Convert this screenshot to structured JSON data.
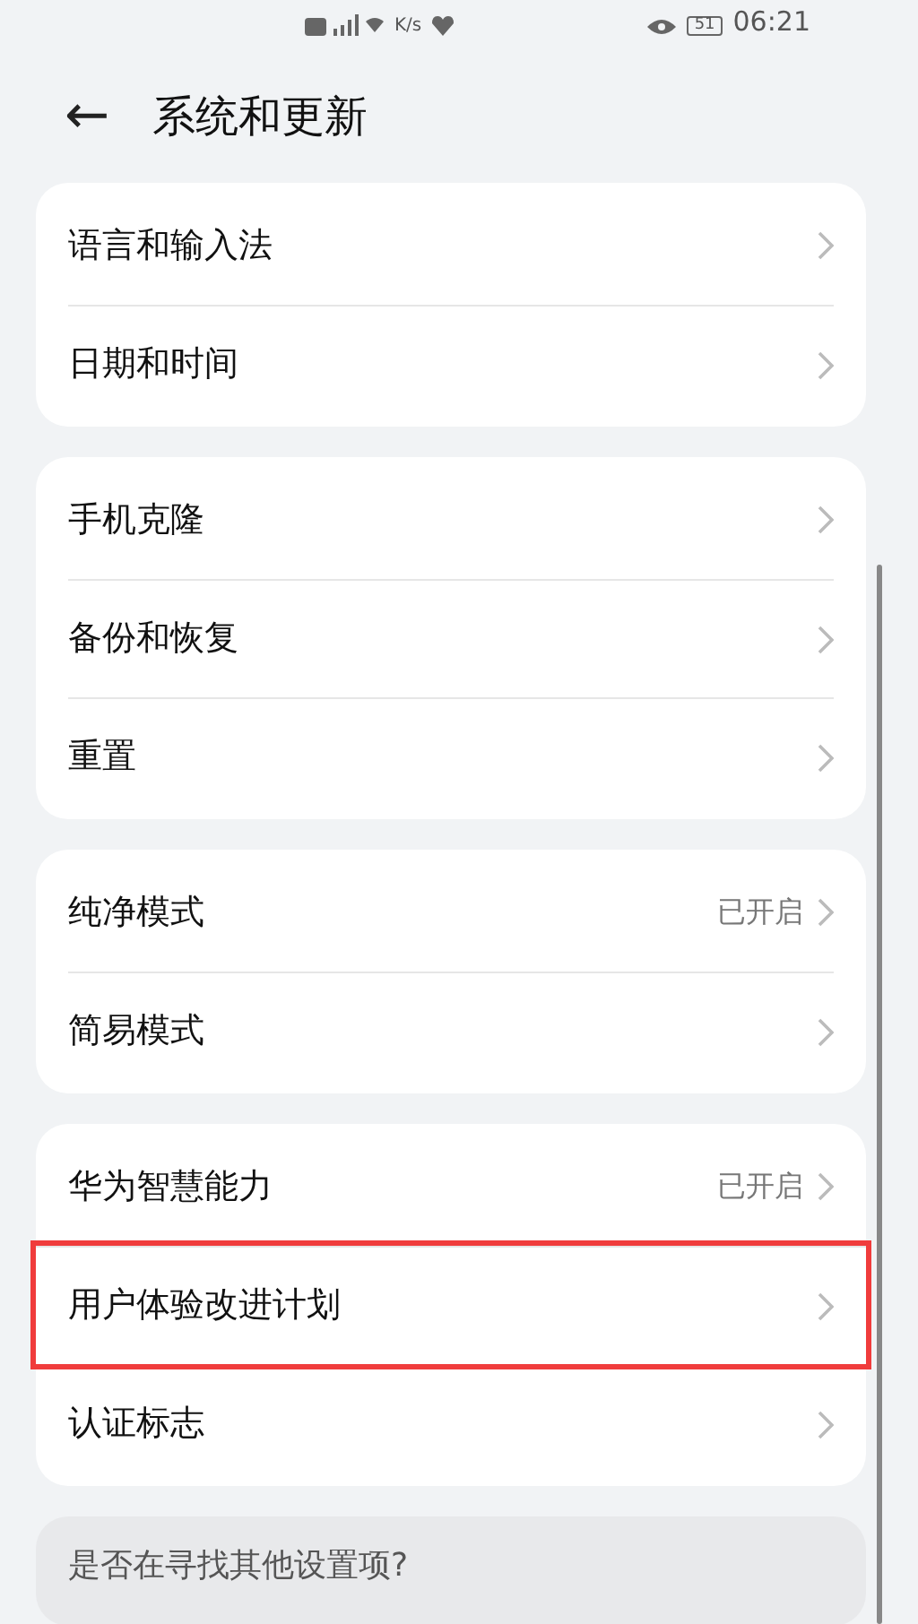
{
  "status_bar": {
    "speed_unit": "K/s",
    "battery": "51",
    "time": "06:21"
  },
  "header": {
    "back_icon": "←",
    "title": "系统和更新"
  },
  "groups": [
    {
      "items": [
        {
          "label": "语言和输入法",
          "highlighted": false
        },
        {
          "label": "日期和时间",
          "highlighted": false
        }
      ]
    },
    {
      "items": [
        {
          "label": "手机克隆",
          "highlighted": false
        },
        {
          "label": "备份和恢复",
          "highlighted": false
        },
        {
          "label": "重置",
          "highlighted": false
        }
      ]
    },
    {
      "items": [
        {
          "label": "纯净模式",
          "value": "已开启",
          "highlighted": false
        },
        {
          "label": "简易模式",
          "highlighted": false
        }
      ]
    },
    {
      "items": [
        {
          "label": "华为智慧能力",
          "value": "已开启",
          "highlighted": false
        },
        {
          "label": "用户体验改进计划",
          "highlighted": true
        },
        {
          "label": "认证标志",
          "highlighted": false
        }
      ]
    }
  ],
  "suggestion": {
    "text": "是否在寻找其他设置项?"
  }
}
